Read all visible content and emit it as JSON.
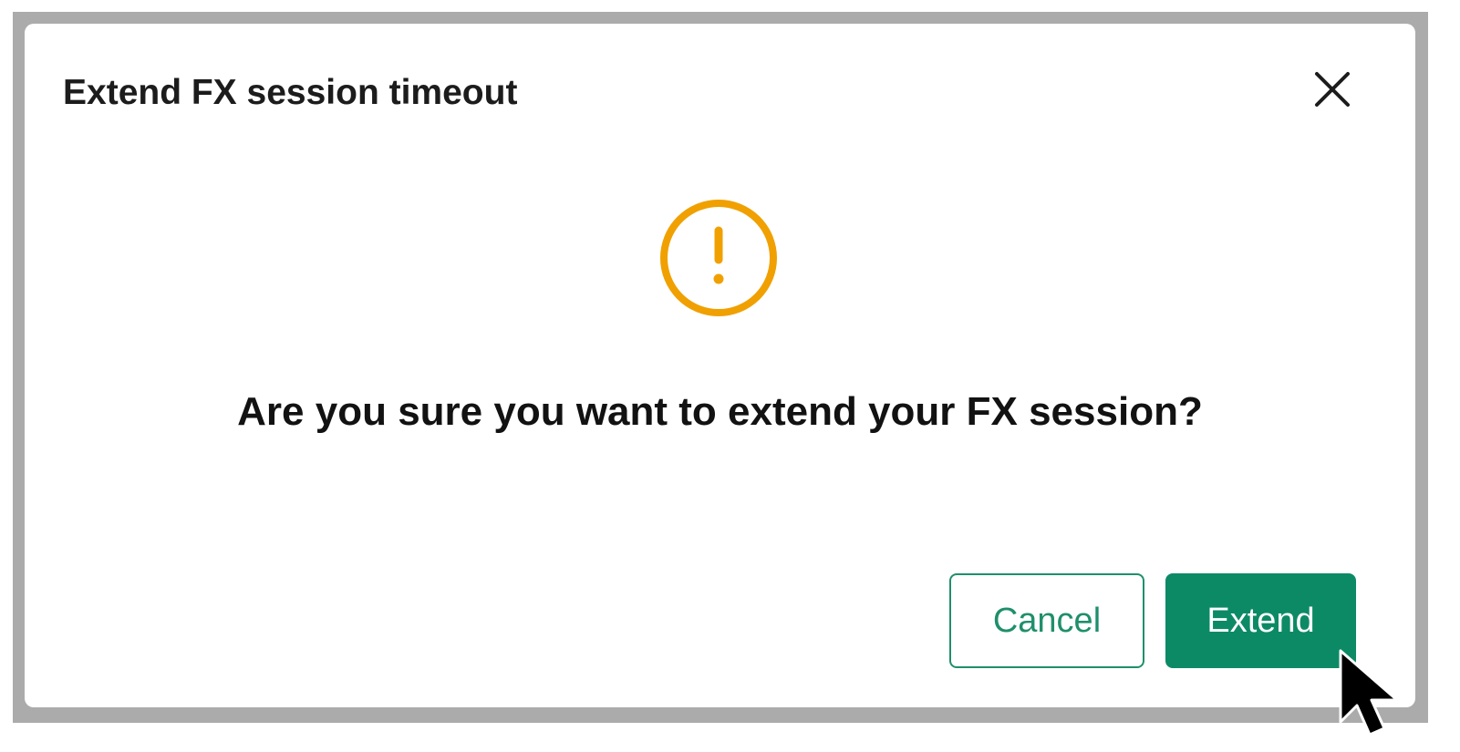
{
  "dialog": {
    "title": "Extend FX session timeout",
    "message": "Are you sure you want to extend your FX session?",
    "icons": {
      "close": "close-icon",
      "warning": "warning-icon"
    },
    "buttons": {
      "cancel_label": "Cancel",
      "extend_label": "Extend"
    }
  },
  "colors": {
    "backdrop": "#ababab",
    "warning": "#f0a000",
    "primary": "#0c8a66",
    "primary_outline": "#1f8f6b",
    "text": "#1c1c1c"
  },
  "cursor": "pointer-cursor"
}
